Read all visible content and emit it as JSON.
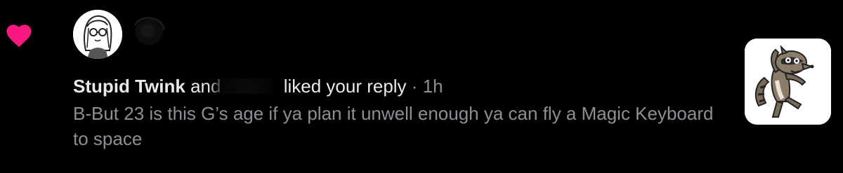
{
  "notification": {
    "type_icon": "heart-icon",
    "type_color": "#f91880",
    "avatars": [
      {
        "icon": "cartoon-girl-avatar"
      },
      {
        "icon": "obscured-avatar"
      }
    ],
    "liker_name": "Stupid Twink",
    "conjunction": "and",
    "action": "liked your reply",
    "separator": "·",
    "timestamp": "1h",
    "reply_text": "B-But 23 is this G’s age if ya plan it unwell enough ya can fly a Magic Keyboard to space",
    "thumbnail": {
      "icon": "raccoon-cartoon-thumbnail"
    }
  },
  "colors": {
    "background": "#000000",
    "primary_text": "#e7e9ea",
    "secondary_text": "#8b9095",
    "heart": "#f91880"
  }
}
